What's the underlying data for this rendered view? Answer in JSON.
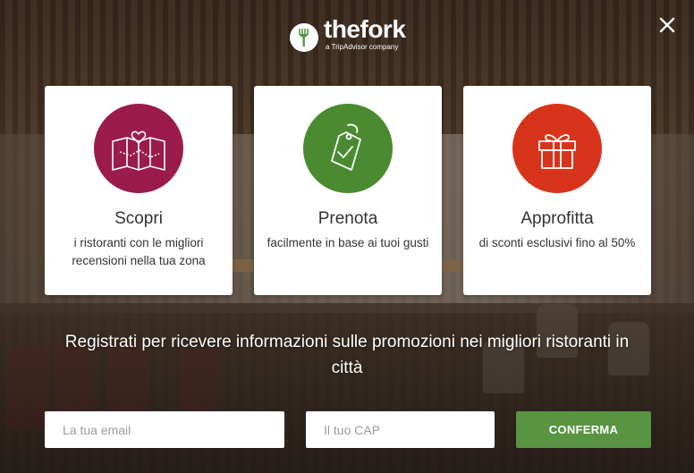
{
  "brand": {
    "name": "thefork",
    "tagline": "a TripAdvisor company"
  },
  "cards": [
    {
      "title": "Scopri",
      "text": "i ristoranti con le migliori recensioni nella tua zona",
      "icon": "map-heart-icon",
      "color": "#9b1b4a"
    },
    {
      "title": "Prenota",
      "text": "facilmente in base ai tuoi gusti",
      "icon": "tag-check-icon",
      "color": "#4a8a30"
    },
    {
      "title": "Approfitta",
      "text": "di sconti esclusivi fino al 50%",
      "icon": "gift-icon",
      "color": "#d8341c"
    }
  ],
  "headline": "Registrati per ricevere informazioni sulle promozioni nei migliori ristoranti in città",
  "form": {
    "email_placeholder": "La tua email",
    "email_value": "",
    "cap_placeholder": "Il tuo CAP",
    "cap_value": "",
    "submit_label": "CONFERMA"
  },
  "colors": {
    "accent": "#589442"
  }
}
